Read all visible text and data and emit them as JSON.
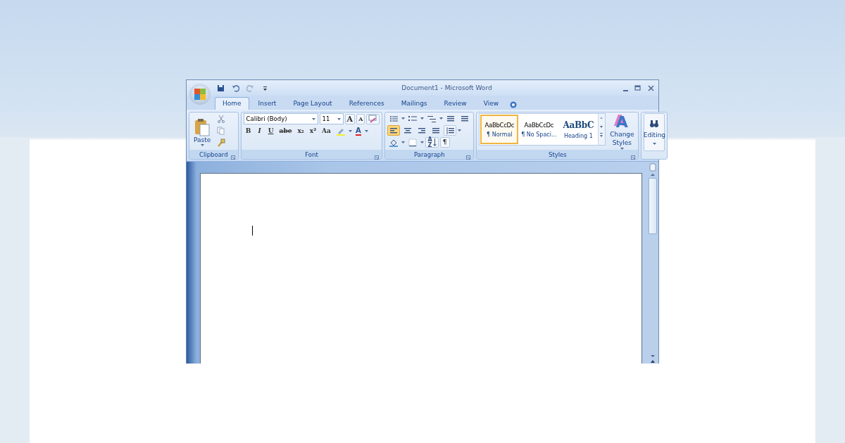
{
  "window": {
    "title": "Document1 - Microsoft Word"
  },
  "tabs": [
    {
      "label": "Home",
      "selected": true
    },
    {
      "label": "Insert",
      "selected": false
    },
    {
      "label": "Page Layout",
      "selected": false
    },
    {
      "label": "References",
      "selected": false
    },
    {
      "label": "Mailings",
      "selected": false
    },
    {
      "label": "Review",
      "selected": false
    },
    {
      "label": "View",
      "selected": false
    }
  ],
  "ribbon": {
    "groups": [
      {
        "kind": "clipboard",
        "label": "Clipboard",
        "paste": "Paste"
      },
      {
        "kind": "font",
        "label": "Font",
        "font_name": "Calibri (Body)",
        "font_size": "11",
        "grow_font": "A",
        "shrink_font": "A",
        "font_color": "A",
        "format_buttons": [
          "B",
          "I",
          "U",
          "abe",
          "x₂",
          "x²",
          "Aa"
        ]
      },
      {
        "kind": "paragraph",
        "label": "Paragraph",
        "show_marks": "¶",
        "sort_letters": [
          "A",
          "Z"
        ],
        "alignments": [
          {
            "kind": "left",
            "selected": true
          },
          {
            "kind": "center",
            "selected": false
          },
          {
            "kind": "right",
            "selected": false
          },
          {
            "kind": "justify",
            "selected": false
          }
        ]
      },
      {
        "kind": "styles",
        "label": "Styles",
        "styles": [
          {
            "preview": "AaBbCcDc",
            "name": "¶ Normal",
            "kind": "body",
            "selected": true
          },
          {
            "preview": "AaBbCcDc",
            "name": "¶ No Spaci...",
            "kind": "body",
            "selected": false
          },
          {
            "preview": "AaBbC",
            "name": "Heading 1",
            "kind": "heading",
            "selected": false
          }
        ],
        "change_styles": "Change Styles",
        "change_styles_icon": "A"
      },
      {
        "kind": "editing",
        "label": "Editing"
      }
    ]
  }
}
